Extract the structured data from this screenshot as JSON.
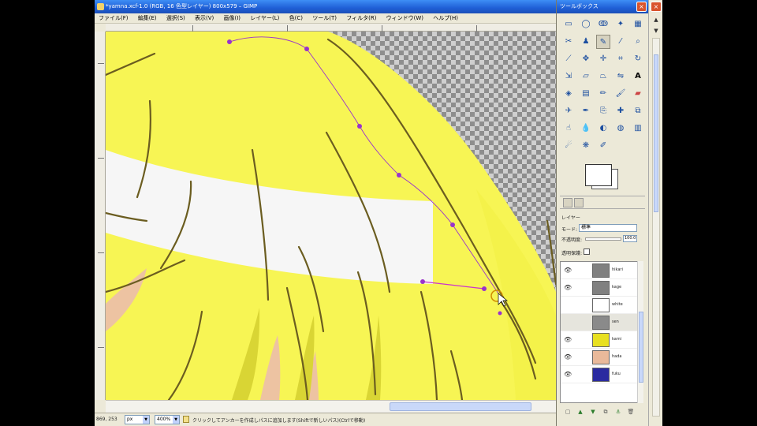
{
  "window": {
    "title": "*yamna.xcf-1.0 (RGB, 16 色型レイヤー) 800x579 – GIMP",
    "menu": [
      "ファイル(F)",
      "編集(E)",
      "選択(S)",
      "表示(V)",
      "画像(I)",
      "レイヤー(L)",
      "色(C)",
      "ツール(T)",
      "フィルタ(R)",
      "ウィンドウ(W)",
      "ヘルプ(H)"
    ]
  },
  "statusbar": {
    "coords": "869, 253",
    "unit": "px",
    "zoom": "400%",
    "message": "クリックしてアンカーを作成しパスに追加します(Shiftで新しいパス)(Ctrlで移動)"
  },
  "toolbox": {
    "title": "ツールボックス",
    "close_label": "×"
  },
  "layers_panel": {
    "layer_label": "レイヤー",
    "mode_label": "モード:",
    "mode_value": "標準",
    "opacity_label": "不透明度:",
    "opacity_value": "100.0",
    "lock_label": "透明保護:",
    "layers": [
      {
        "name": "hikari",
        "thumb": "#808080",
        "selected": false
      },
      {
        "name": "kage",
        "thumb": "#808080",
        "selected": false
      },
      {
        "name": "white",
        "thumb": "#ffffff",
        "selected": false
      },
      {
        "name": "sen",
        "thumb": "#8a8a8a",
        "selected": true
      },
      {
        "name": "kami",
        "thumb": "#e8e020",
        "selected": false
      },
      {
        "name": "hada",
        "thumb": "#e9b99a",
        "selected": false
      },
      {
        "name": "fuku",
        "thumb": "#2a2aa0",
        "selected": false
      }
    ]
  },
  "colors": {
    "hair_yellow": "#f7f554",
    "hair_shadow": "#e4e23a",
    "line_olive": "#6b5d20",
    "path_purple": "#9933cc",
    "skin": "#edc3a2",
    "checker": "#9a9a9a",
    "title_blue": "#1f5fd6"
  },
  "icons": [
    "close-icon",
    "eye-icon",
    "new-layer-icon",
    "raise-layer-icon",
    "lower-layer-icon",
    "duplicate-layer-icon",
    "anchor-layer-icon",
    "delete-layer-icon"
  ]
}
